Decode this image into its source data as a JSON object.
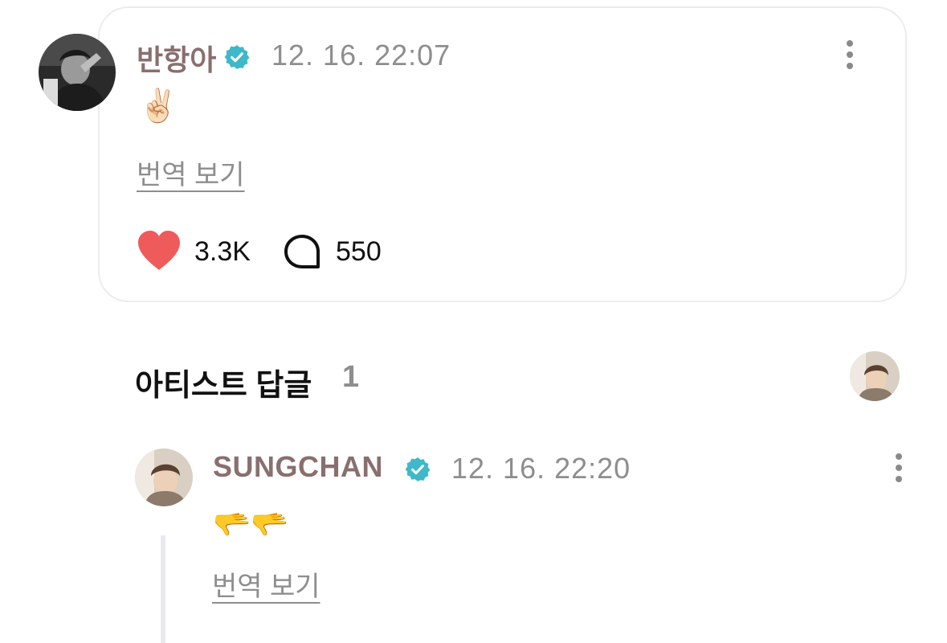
{
  "post": {
    "author": "반항아",
    "timestamp": "12. 16. 22:07",
    "body": "✌🏻",
    "translate_label": "번역 보기",
    "likes": "3.3K",
    "comments": "550",
    "avatar_icon": "profile-photo-bw",
    "menu_icon": "more-vertical-icon"
  },
  "artist_replies": {
    "title": "아티스트 답글",
    "count": "1"
  },
  "reply": {
    "author": "SUNGCHAN",
    "timestamp": "12. 16. 22:20",
    "body": "🫳🫳",
    "translate_label": "번역 보기",
    "avatar_icon": "profile-photo-color",
    "menu_icon": "more-vertical-icon"
  },
  "colors": {
    "author_name": "#8a6f6f",
    "verified_badge": "#3fb8c9",
    "heart": "#ef5b5b",
    "muted_text": "#8e8e8e",
    "card_border": "#ececf0"
  }
}
